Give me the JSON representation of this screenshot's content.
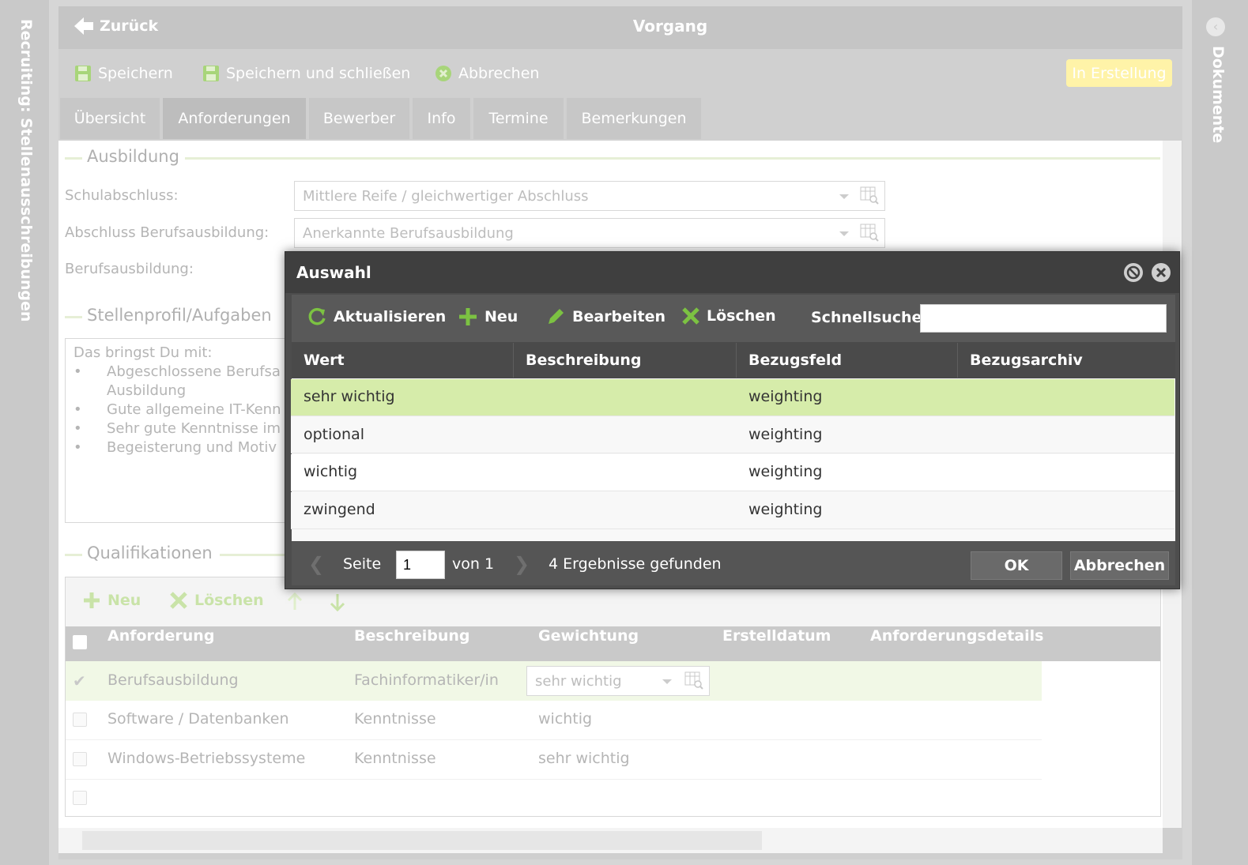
{
  "left_rail": {
    "title": "Recruiting: Stellenausschreibungen"
  },
  "right_rail": {
    "title": "Dokumente"
  },
  "titlebar": {
    "back_label": "Zurück",
    "title": "Vorgang"
  },
  "toolbar": {
    "save": "Speichern",
    "save_close": "Speichern und schließen",
    "cancel": "Abbrechen",
    "status": "In Erstellung"
  },
  "tabs": [
    {
      "label": "Übersicht"
    },
    {
      "label": "Anforderungen"
    },
    {
      "label": "Bewerber"
    },
    {
      "label": "Info"
    },
    {
      "label": "Termine"
    },
    {
      "label": "Bemerkungen"
    }
  ],
  "ausbildung": {
    "title": "Ausbildung",
    "schul_label": "Schulabschluss:",
    "schul_value": "Mittlere Reife / gleichwertiger Abschluss",
    "beruf_label": "Abschluss Berufsausbildung:",
    "beruf_value": "Anerkannte Berufsausbildung",
    "ausbildung_label": "Berufsausbildung:"
  },
  "profil": {
    "title": "Stellenprofil/Aufgaben",
    "text": {
      "heading": "Das bringst Du mit:",
      "items": [
        "Abgeschlossene Berufsa",
        "Ausbildung",
        "Gute allgemeine IT-Kenn",
        "Sehr gute Kenntnisse im",
        "Begeisterung und Motiv"
      ]
    }
  },
  "qualifikationen": {
    "title": "Qualifikationen",
    "new": "Neu",
    "delete": "Löschen",
    "headers": [
      "Anforderung",
      "Beschreibung",
      "Gewichtung",
      "Erstelldatum",
      "Anforderungsdetails"
    ],
    "rows": [
      {
        "anforderung": "Berufsausbildung",
        "beschreibung": "Fachinformatiker/in",
        "gewichtung": "sehr wichtig",
        "checked": true
      },
      {
        "anforderung": "Software / Datenbanken",
        "beschreibung": "Kenntnisse",
        "gewichtung": "wichtig",
        "checked": false
      },
      {
        "anforderung": "Windows-Betriebssysteme",
        "beschreibung": "Kenntnisse",
        "gewichtung": "sehr wichtig",
        "checked": false
      }
    ]
  },
  "dialog": {
    "title": "Auswahl",
    "refresh": "Aktualisieren",
    "new": "Neu",
    "edit": "Bearbeiten",
    "delete": "Löschen",
    "quicksearch_label": "Schnellsuche",
    "quicksearch_value": "",
    "headers": [
      "Wert",
      "Beschreibung",
      "Bezugsfeld",
      "Bezugsarchiv"
    ],
    "rows": [
      {
        "wert": "sehr wichtig",
        "bezugsfeld": "weighting"
      },
      {
        "wert": "optional",
        "bezugsfeld": "weighting"
      },
      {
        "wert": "wichtig",
        "bezugsfeld": "weighting"
      },
      {
        "wert": "zwingend",
        "bezugsfeld": "weighting"
      }
    ],
    "page_label": "Seite",
    "page_value": "1",
    "of_label": "von 1",
    "results": "4 Ergebnisse gefunden",
    "ok": "OK",
    "cancel": "Abbrechen"
  },
  "colors": {
    "accent_green": "#7cc242",
    "selected_row": "#d6ecaa",
    "status_badge": "#fff3a8"
  }
}
